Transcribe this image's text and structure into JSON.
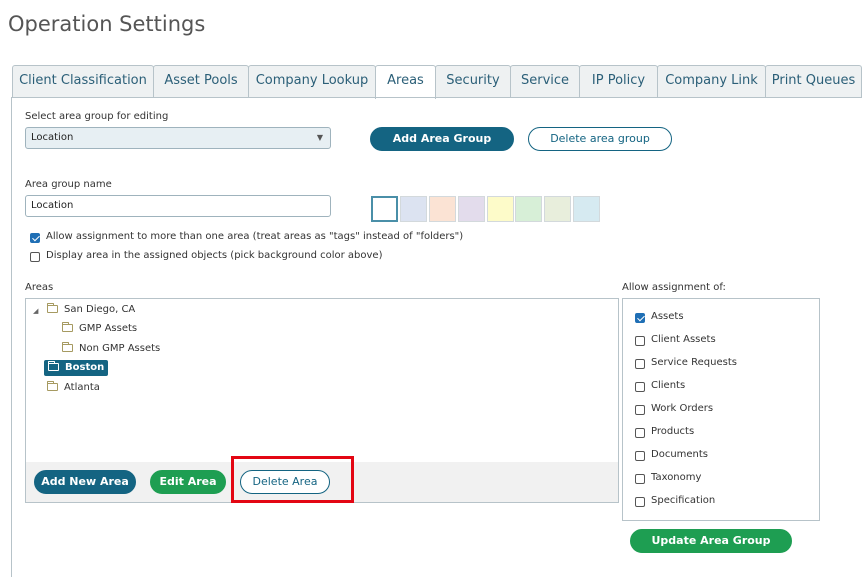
{
  "page_title": "Operation Settings",
  "tabs": [
    {
      "label": "Client Classification",
      "active": false
    },
    {
      "label": "Asset Pools",
      "active": false
    },
    {
      "label": "Company Lookup",
      "active": false
    },
    {
      "label": "Areas",
      "active": true
    },
    {
      "label": "Security",
      "active": false
    },
    {
      "label": "Service",
      "active": false
    },
    {
      "label": "IP Policy",
      "active": false
    },
    {
      "label": "Company Link",
      "active": false
    },
    {
      "label": "Print Queues",
      "active": false
    }
  ],
  "area_group_select": {
    "label": "Select area group for editing",
    "value": "Location"
  },
  "buttons": {
    "add_area_group": "Add Area Group",
    "delete_area_group": "Delete area group",
    "add_new_area": "Add New Area",
    "edit_area": "Edit Area",
    "delete_area": "Delete Area",
    "update_area_group": "Update Area Group"
  },
  "area_group_name": {
    "label": "Area group name",
    "value": "Location"
  },
  "swatch_colors": [
    "#ffffff",
    "#dce3f1",
    "#fbe3d4",
    "#e3dcec",
    "#fdfbc9",
    "#d7efd7",
    "#e8eedc",
    "#d6eaf1"
  ],
  "options": [
    {
      "label": "Allow assignment to more than one area (treat areas as \"tags\" instead of \"folders\")",
      "checked": true
    },
    {
      "label": "Display area in the assigned objects (pick background color above)",
      "checked": false
    }
  ],
  "areas": {
    "label": "Areas",
    "nodes": [
      {
        "label": "San Diego, CA",
        "expanded": true,
        "selected": false
      },
      {
        "label": "GMP Assets",
        "selected": false
      },
      {
        "label": "Non GMP Assets",
        "selected": false
      },
      {
        "label": "Boston",
        "selected": true
      },
      {
        "label": "Atlanta",
        "selected": false
      }
    ]
  },
  "allow_assignment": {
    "label": "Allow assignment of:",
    "items": [
      {
        "label": "Assets",
        "checked": true
      },
      {
        "label": "Client Assets",
        "checked": false
      },
      {
        "label": "Service Requests",
        "checked": false
      },
      {
        "label": "Clients",
        "checked": false
      },
      {
        "label": "Work Orders",
        "checked": false
      },
      {
        "label": "Products",
        "checked": false
      },
      {
        "label": "Documents",
        "checked": false
      },
      {
        "label": "Taxonomy",
        "checked": false
      },
      {
        "label": "Specification",
        "checked": false
      }
    ]
  },
  "colors": {
    "primary": "#146482",
    "success": "#1e9e52",
    "highlight": "#e30613",
    "checkbox_checked": "#1f6fb5"
  }
}
